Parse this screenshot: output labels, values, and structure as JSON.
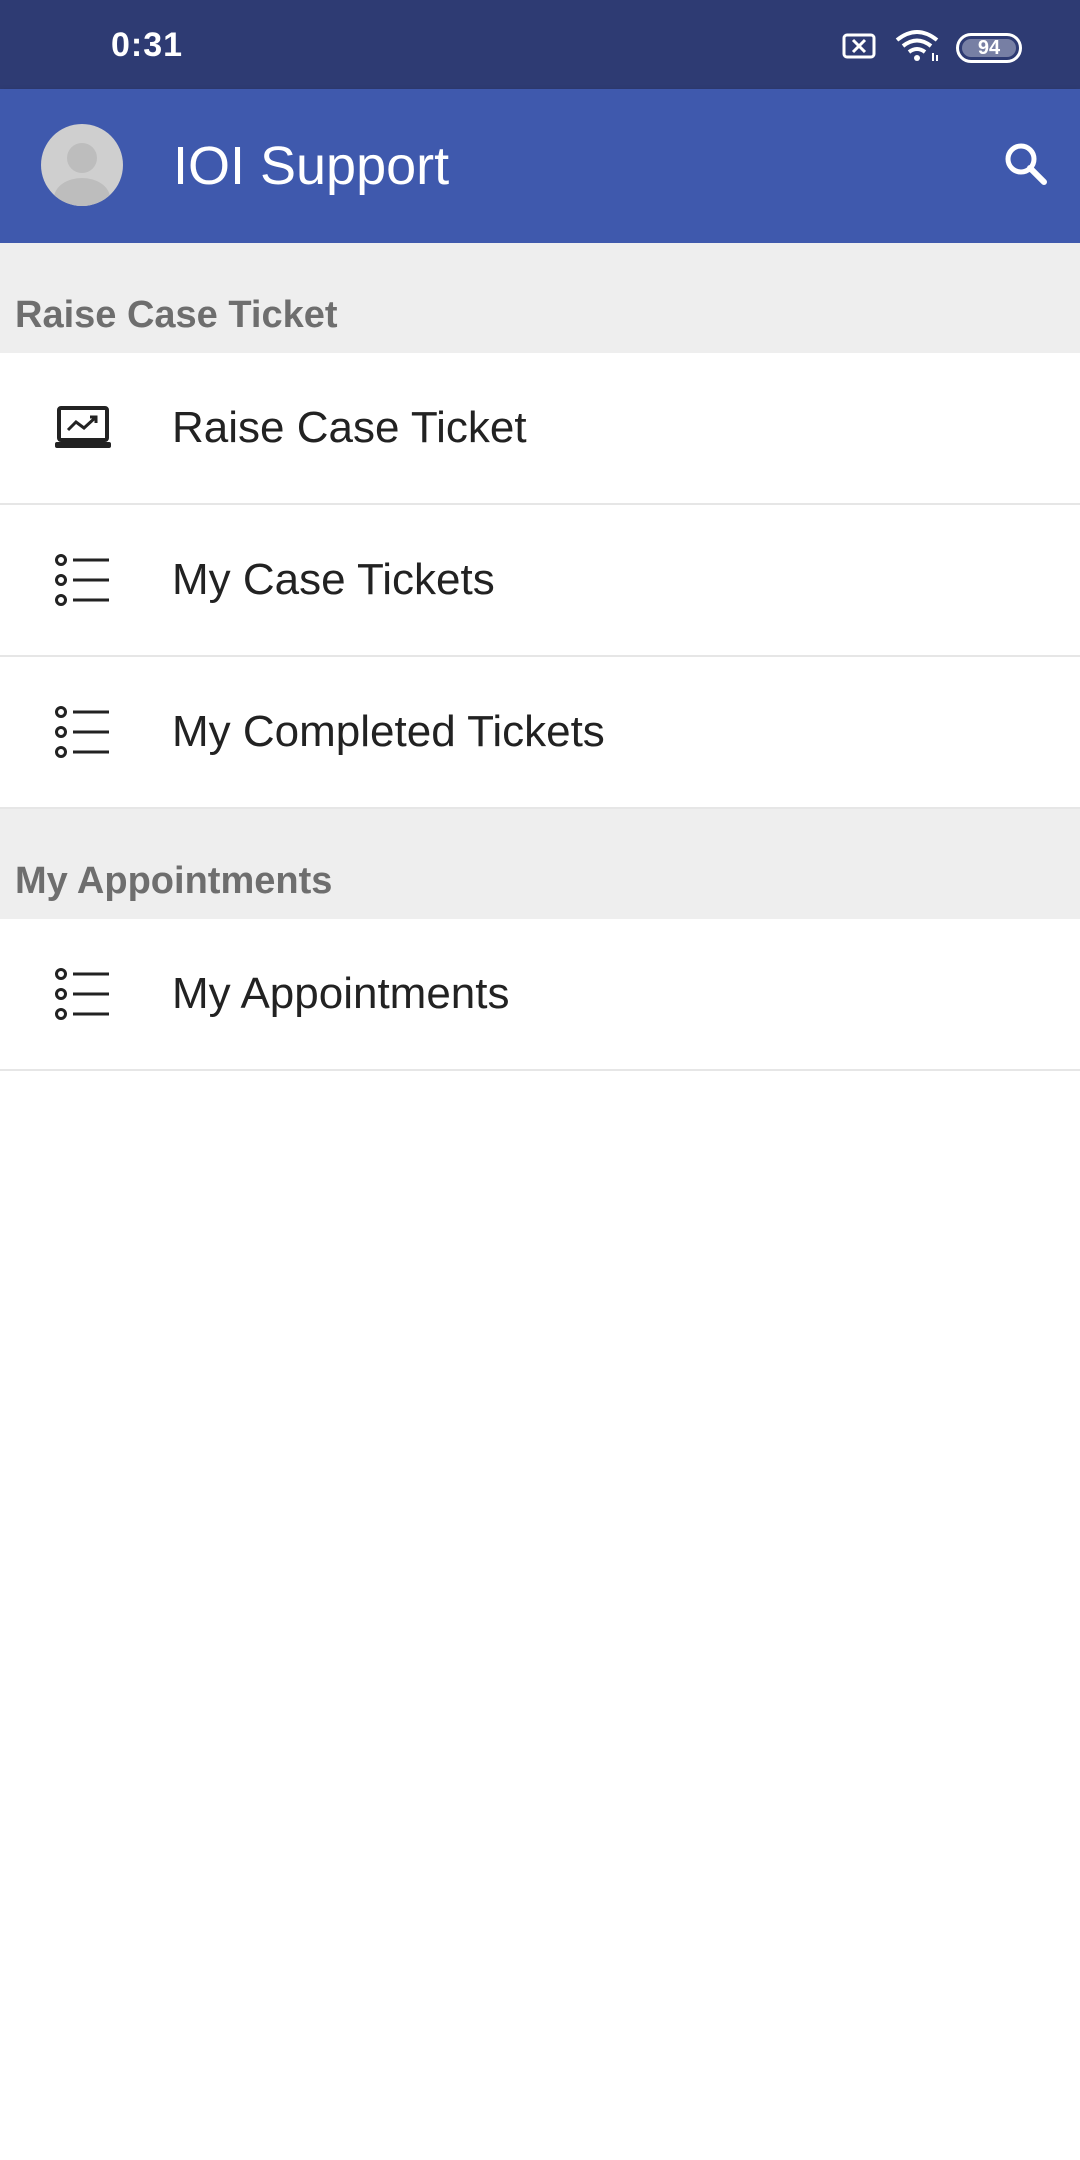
{
  "status_bar": {
    "time": "0:31",
    "battery": "94",
    "icons": [
      "sim-error-icon",
      "wifi-icon",
      "battery-icon"
    ]
  },
  "app_bar": {
    "title": "IOI Support",
    "icons": [
      "avatar-icon",
      "search-icon"
    ],
    "color": "#3f59ad"
  },
  "sections": [
    {
      "header": "Raise Case Ticket",
      "items": [
        {
          "label": "Raise Case Ticket",
          "icon": "laptop-chart-icon"
        },
        {
          "label": "My Case Tickets",
          "icon": "list-icon"
        },
        {
          "label": "My Completed Tickets",
          "icon": "list-icon"
        }
      ]
    },
    {
      "header": "My Appointments",
      "items": [
        {
          "label": "My Appointments",
          "icon": "list-icon"
        }
      ]
    }
  ]
}
